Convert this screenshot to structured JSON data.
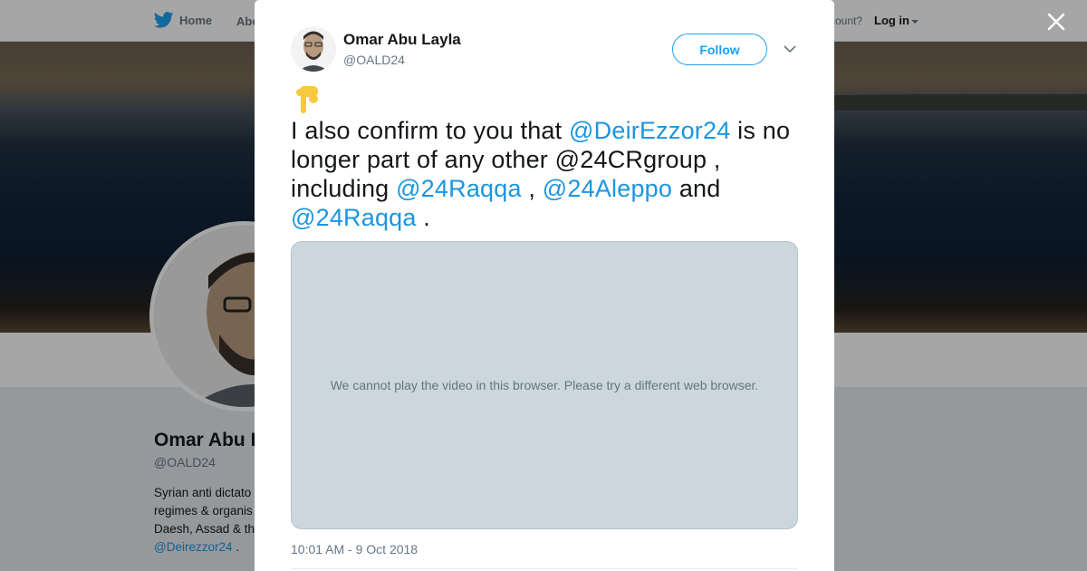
{
  "nav": {
    "home_label": "Home",
    "about_label": "Abo",
    "account_text": "ccount?",
    "login_label": "Log in"
  },
  "background_profile": {
    "name": "Omar Abu L",
    "handle": "@OALD24",
    "bio_lines": [
      "Syrian anti dictato",
      "regimes & organis",
      "Daesh, Assad & th"
    ],
    "bio_link": "@Deirezzor24",
    "bio_link_suffix": " ."
  },
  "tweet": {
    "author_name": "Omar Abu Layla",
    "author_handle": "@OALD24",
    "follow_label": "Follow",
    "emoji": "backhand-index-pointing-down",
    "text": {
      "p1": "I also confirm to you that ",
      "m1": "@DeirEzzor24",
      "p2": " is no longer part of any other @24CRgroup , including ",
      "m2": "@24Raqqa",
      "p3": " , ",
      "m3": "@24Aleppo",
      "p4": " and ",
      "m4": "@24Raqqa",
      "p5": " ."
    },
    "video_message": "We cannot play the video in this browser. Please try a different web browser.",
    "timestamp": "10:01 AM - 9 Oct 2018"
  },
  "icons": {
    "brand": "bird-icon",
    "close": "close-icon",
    "more": "chevron-down-icon"
  },
  "colors": {
    "accent": "#1da1f2",
    "link": "#1b95e0",
    "video_placeholder": "#ccd6dd"
  }
}
